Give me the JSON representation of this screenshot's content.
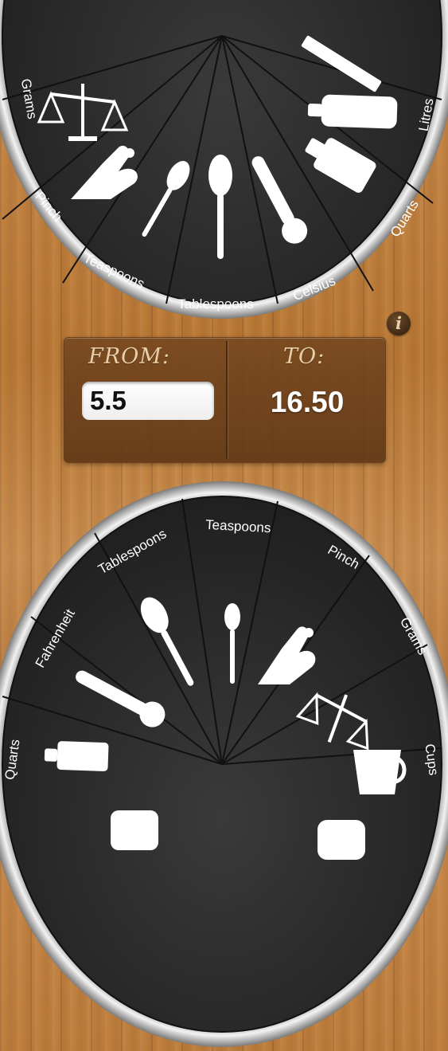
{
  "colors": {
    "wheel_face": "#2b2b2b",
    "wheel_rim": "#c0c0c0",
    "wood": "#c08343",
    "panel": "#6e4320"
  },
  "converter": {
    "from_label": "FROM:",
    "to_label": "TO:",
    "from_value": "5.5",
    "to_value": "16.50"
  },
  "info_button": {
    "glyph": "i",
    "icon": "info-icon"
  },
  "top_wheel": {
    "segments": [
      {
        "label": "Grams",
        "icon": "scale-icon"
      },
      {
        "label": "Pinch",
        "icon": "pinch-hand-icon"
      },
      {
        "label": "Teaspoons",
        "icon": "teaspoon-icon"
      },
      {
        "label": "Tablespoons",
        "icon": "tablespoon-icon"
      },
      {
        "label": "Celsius",
        "icon": "thermometer-icon"
      },
      {
        "label": "Quarts",
        "icon": "bottle-icon"
      },
      {
        "label": "Litres",
        "icon": "litre-bottle-icon"
      },
      {
        "label": "",
        "icon": "ruler-icon"
      }
    ]
  },
  "bottom_wheel": {
    "segments": [
      {
        "label": "Quarts",
        "icon": "bottle-icon"
      },
      {
        "label": "Fahrenheit",
        "icon": "thermometer-icon"
      },
      {
        "label": "Tablespoons",
        "icon": "tablespoon-icon"
      },
      {
        "label": "Teaspoons",
        "icon": "teaspoon-icon"
      },
      {
        "label": "Pinch",
        "icon": "pinch-hand-icon"
      },
      {
        "label": "Grams",
        "icon": "scale-icon"
      },
      {
        "label": "Cups",
        "icon": "cup-icon"
      }
    ]
  }
}
